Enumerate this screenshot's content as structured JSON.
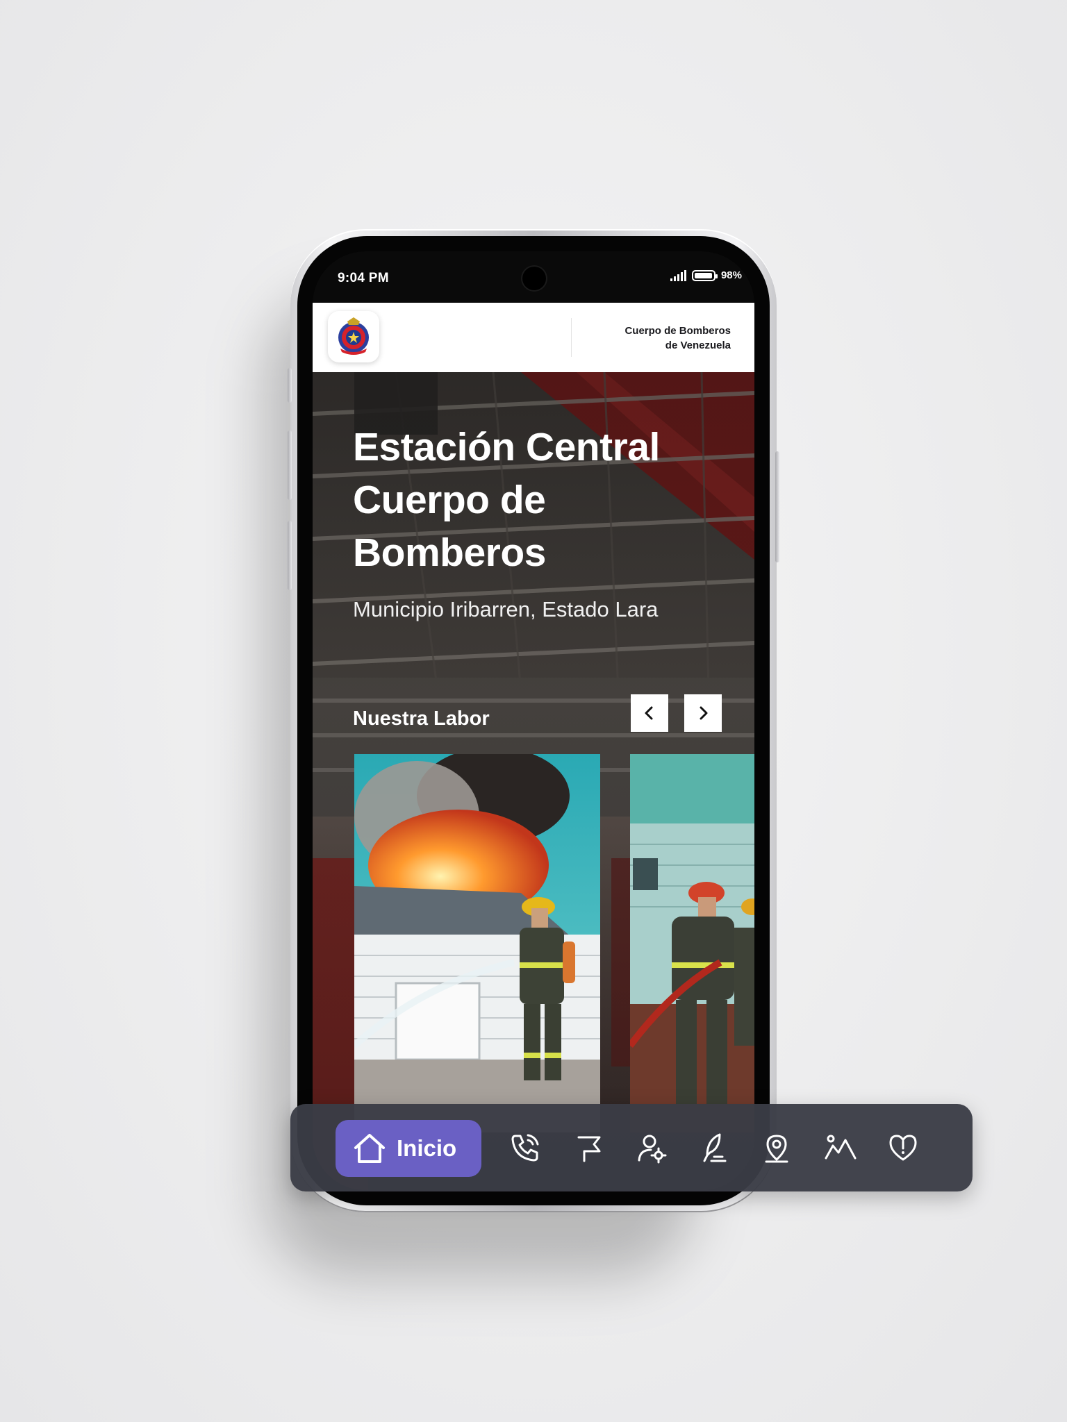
{
  "status_bar": {
    "time": "9:04 PM",
    "battery": "98%",
    "battery_level": 0.98
  },
  "header": {
    "logo_icon": "firefighters-crest-icon",
    "org_name_line1": "Cuerpo de Bomberos",
    "org_name_line2": "de Venezuela"
  },
  "hero": {
    "title": "Estación Central Cuerpo de Bomberos",
    "subtitle": "Municipio Iribarren, Estado Lara"
  },
  "gallery": {
    "section_title": "Nuestra Labor",
    "prev_icon": "chevron-left-icon",
    "next_icon": "chevron-right-icon",
    "cards": [
      {
        "image": "firefighter-hosing-burning-house"
      },
      {
        "image": "firefighters-handling-hose"
      }
    ]
  },
  "bottom_nav": {
    "home_label": "Inicio",
    "active_color": "#6a60c4",
    "items": [
      {
        "icon": "phone-call-icon"
      },
      {
        "icon": "flag-icon"
      },
      {
        "icon": "user-settings-icon"
      },
      {
        "icon": "quill-icon"
      },
      {
        "icon": "location-pin-icon"
      },
      {
        "icon": "person-mountain-icon"
      },
      {
        "icon": "heart-alert-icon"
      }
    ]
  }
}
